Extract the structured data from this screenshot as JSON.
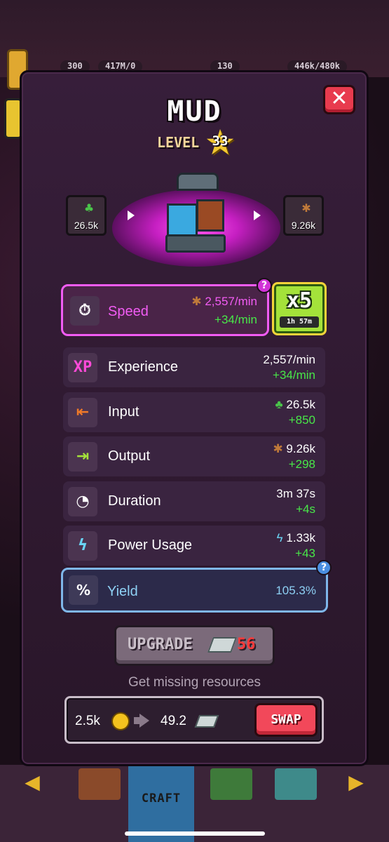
{
  "top_stats": [
    "300",
    "417M/0",
    "130",
    "446k/480k"
  ],
  "title": "MUD",
  "level": {
    "label": "LEVEL",
    "value": "33"
  },
  "input_resource": {
    "amount": "26.5k",
    "icon": "sprout-icon"
  },
  "output_resource": {
    "amount": "9.26k",
    "icon": "mud-splat-icon"
  },
  "speed": {
    "label": "Speed",
    "value": "2,557/min",
    "delta": "+34/min",
    "help": "?"
  },
  "boost": {
    "label": "x5",
    "time": "1h 57m"
  },
  "stats": [
    {
      "id": "experience",
      "label": "Experience",
      "icon_text": "XP",
      "value": "2,557/min",
      "delta": "+34/min"
    },
    {
      "id": "input",
      "label": "Input",
      "value": "26.5k",
      "delta": "+850"
    },
    {
      "id": "output",
      "label": "Output",
      "value": "9.26k",
      "delta": "+298"
    },
    {
      "id": "duration",
      "label": "Duration",
      "value": "3m 37s",
      "delta": "+4s"
    },
    {
      "id": "power",
      "label": "Power Usage",
      "value": "1.33k",
      "delta": "+43"
    }
  ],
  "yield": {
    "label": "Yield",
    "value": "105.3%",
    "icon_text": "%",
    "help": "?"
  },
  "upgrade": {
    "label": "UPGRADE",
    "cost": "56"
  },
  "missing_text": "Get missing resources",
  "swap": {
    "from": "2.5k",
    "to": "49.2",
    "button": "SWAP"
  },
  "nav": {
    "craft_label": "CRAFT"
  },
  "colors": {
    "speed_accent": "#f25cf4",
    "delta_green": "#48e848",
    "yield_accent": "#8ed0f4",
    "close_red": "#e83b4e",
    "boost_green": "#a4e23a",
    "upgrade_cost_red": "#ff3a3a"
  }
}
